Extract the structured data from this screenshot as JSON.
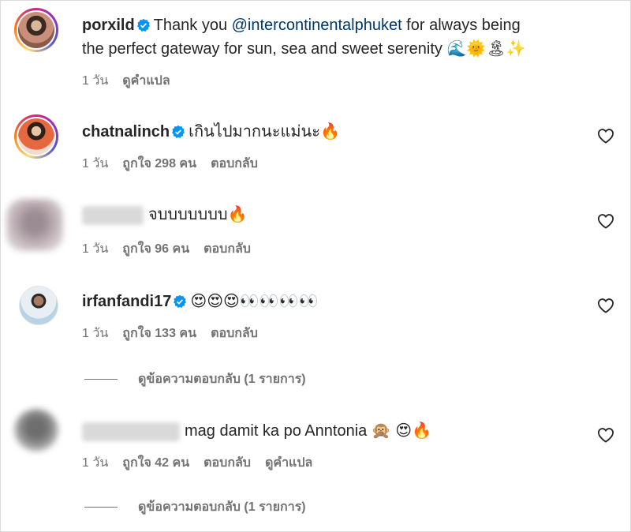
{
  "caption": {
    "username": "porxild",
    "text_before": "Thank you ",
    "mention": "@intercontinentalphuket",
    "text_after": " for always being",
    "line2": "the perfect gateway for sun, sea and sweet serenity",
    "emojis": "🌊🌞🏝✨",
    "time": "1 วัน",
    "translate": "ดูคำแปล"
  },
  "comments": [
    {
      "username": "chatnalinch",
      "text": "เกินไปมากนะแม่นะ🔥",
      "time": "1 วัน",
      "likes": "ถูกใจ 298 คน",
      "reply": "ตอบกลับ"
    },
    {
      "username": "",
      "text": "จบบบบบบบ🔥",
      "time": "1 วัน",
      "likes": "ถูกใจ 96 คน",
      "reply": "ตอบกลับ"
    },
    {
      "username": "irfanfandi17",
      "text": "😍😍😍👀👀👀👀",
      "time": "1 วัน",
      "likes": "ถูกใจ 133 คน",
      "reply": "ตอบกลับ",
      "view_replies": "ดูข้อความตอบกลับ (1 รายการ)"
    },
    {
      "username": "",
      "text": "mag damit ka po Anntonia 🙊 😍🔥",
      "time": "1 วัน",
      "likes": "ถูกใจ 42 คน",
      "reply": "ตอบกลับ",
      "translate": "ดูคำแปล",
      "view_replies": "ดูข้อความตอบกลับ (1 รายการ)"
    }
  ],
  "colors": {
    "verified": "#0095f6",
    "mention": "#00376b",
    "secondary": "#737373"
  }
}
